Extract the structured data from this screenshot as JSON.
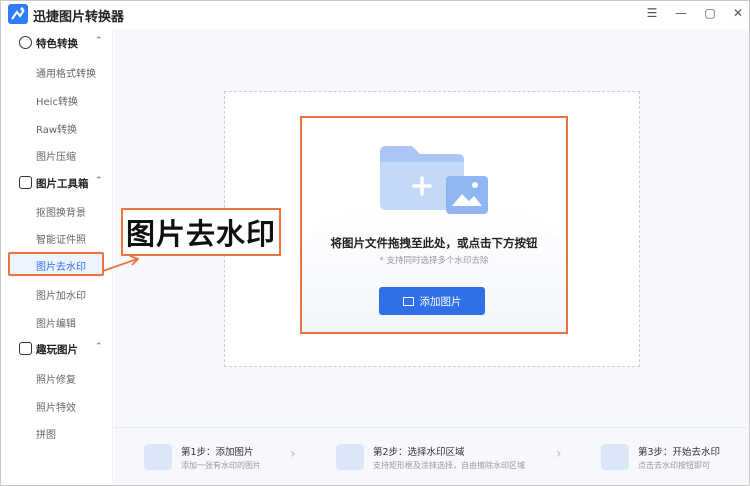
{
  "app": {
    "title": "迅捷图片转换器",
    "window_controls": [
      "☰",
      "—",
      "▢",
      "✕"
    ]
  },
  "sidebar": {
    "groups": [
      {
        "label": "特色转换",
        "icon": "convert-icon",
        "items": [
          "通用格式转换",
          "Heic转换",
          "Raw转换",
          "图片压缩"
        ]
      },
      {
        "label": "图片工具箱",
        "icon": "toolbox-icon",
        "items": [
          "抠图换背景",
          "智能证件照",
          "图片去水印",
          "图片加水印",
          "图片编辑"
        ]
      },
      {
        "label": "趣玩图片",
        "icon": "fun-image-icon",
        "items": [
          "照片修复",
          "照片特效",
          "拼图"
        ]
      }
    ],
    "active_item": "图片去水印"
  },
  "drop_zone": {
    "title": "将图片文件拖拽至此处，或点击下方按钮",
    "subtitle": "* 支持同时选择多个水印去除",
    "button_label": "添加图片"
  },
  "steps": [
    {
      "title": "第1步：添加图片",
      "desc": "添加一张有水印的图片"
    },
    {
      "title": "第2步：选择水印区域",
      "desc": "支持矩形框及涂抹选择，自由擦除水印区域"
    },
    {
      "title": "第3步：开始去水印",
      "desc": "点击去水印按钮即可"
    }
  ],
  "annotation": {
    "label": "图片去水印"
  },
  "colors": {
    "accent": "#2f6fe8",
    "highlight": "#e9743f"
  }
}
